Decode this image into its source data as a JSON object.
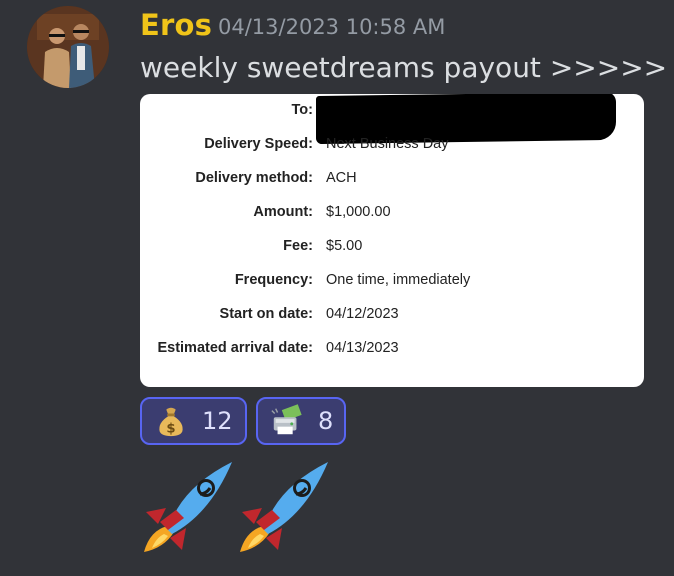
{
  "message": {
    "username": "Eros",
    "timestamp": "04/13/2023 10:58 AM",
    "text": "weekly sweetdreams payout >>>>>",
    "username_color": "#f0c419"
  },
  "attachment": {
    "rows": [
      {
        "label": "To:",
        "value": ""
      },
      {
        "label": "Delivery Speed:",
        "value": "Next Business Day"
      },
      {
        "label": "Delivery method:",
        "value": "ACH"
      },
      {
        "label": "Amount:",
        "value": "$1,000.00"
      },
      {
        "label": "Fee:",
        "value": "$5.00"
      },
      {
        "label": "Frequency:",
        "value": "One time, immediately"
      },
      {
        "label": "Start on date:",
        "value": "04/12/2023"
      },
      {
        "label": "Estimated arrival date:",
        "value": "04/13/2023"
      }
    ]
  },
  "reactions": [
    {
      "emoji": "money-bag-icon",
      "count": "12"
    },
    {
      "emoji": "money-printer-icon",
      "count": "8"
    }
  ],
  "emojis": [
    "rocket-icon",
    "rocket-icon"
  ],
  "colors": {
    "background": "#313338",
    "reaction_bg": "#3b3d70",
    "reaction_border": "#5865f2"
  }
}
